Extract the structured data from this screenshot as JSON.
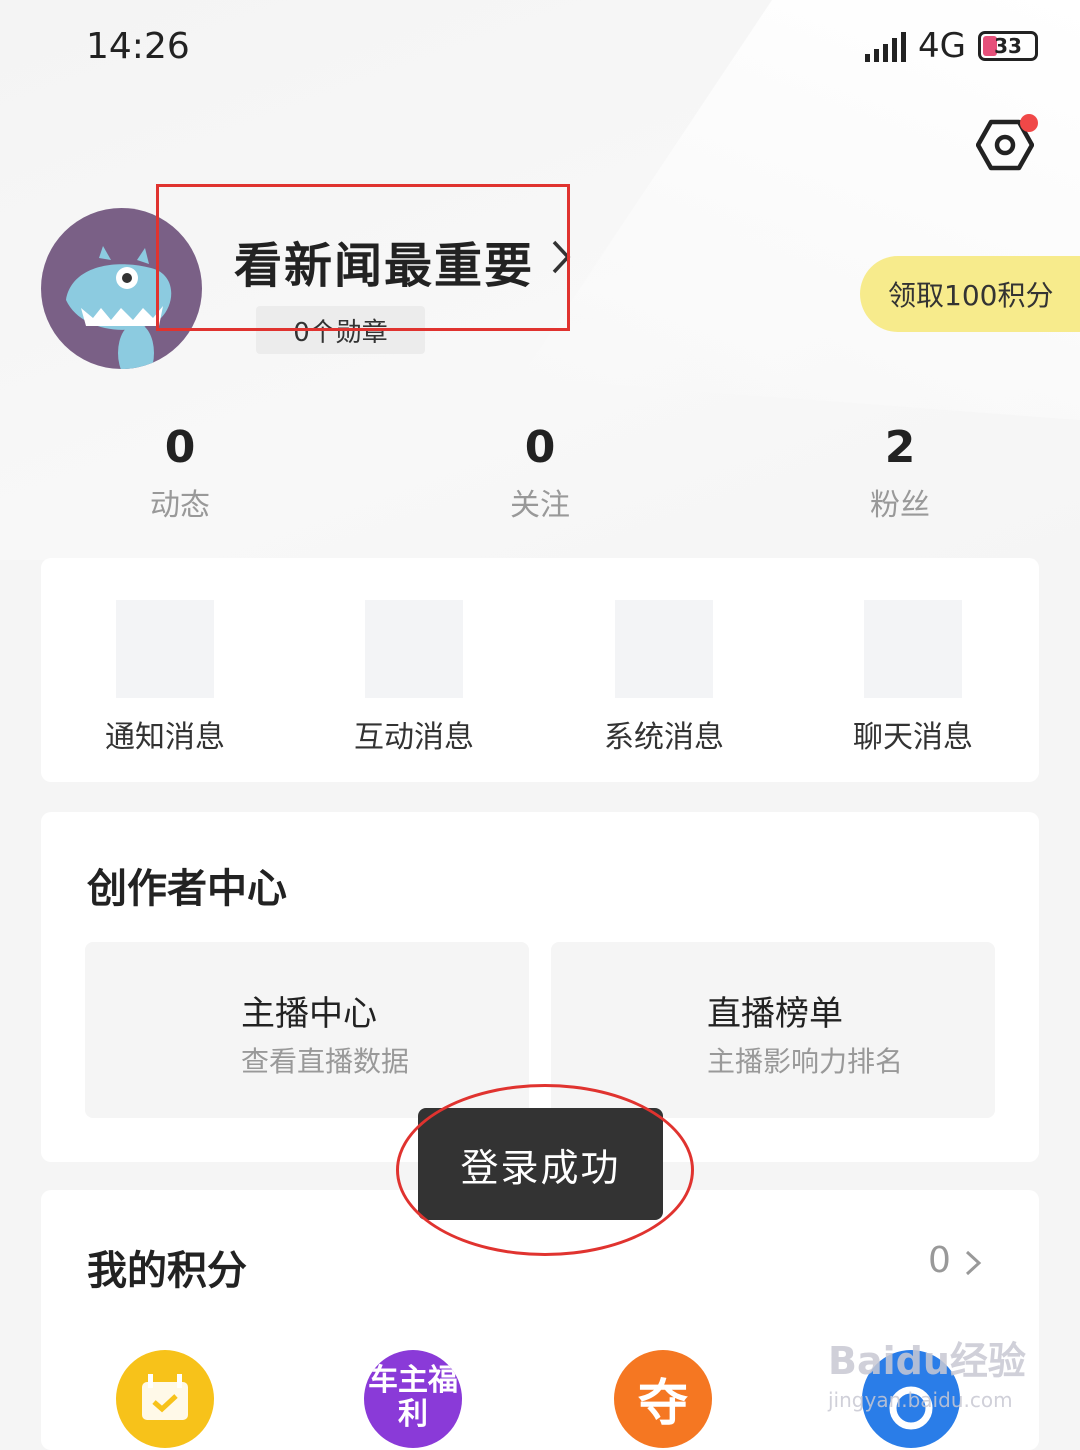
{
  "status_bar": {
    "time": "14:26",
    "network": "4G",
    "battery": "33"
  },
  "profile": {
    "username": "看新闻最重要",
    "badges": "0个勋章",
    "claim_points": "领取100积分"
  },
  "stats": [
    {
      "value": "0",
      "label": "动态"
    },
    {
      "value": "0",
      "label": "关注"
    },
    {
      "value": "2",
      "label": "粉丝"
    }
  ],
  "messages": [
    {
      "label": "通知消息"
    },
    {
      "label": "互动消息"
    },
    {
      "label": "系统消息"
    },
    {
      "label": "聊天消息"
    }
  ],
  "creator_center": {
    "title": "创作者中心",
    "items": [
      {
        "title": "主播中心",
        "desc": "查看直播数据"
      },
      {
        "title": "直播榜单",
        "desc": "主播影响力排名"
      }
    ]
  },
  "toast": {
    "text": "登录成功"
  },
  "my_points": {
    "title": "我的积分",
    "value": "0",
    "icons": [
      {
        "name": "calendar-checkin-icon",
        "color": "#f7c21a"
      },
      {
        "name": "car-owner-welfare-icon",
        "color": "#8a3ad8",
        "text": "车主福利"
      },
      {
        "name": "grab-icon",
        "color": "#f57722",
        "text": "夺"
      },
      {
        "name": "blue-reward-icon",
        "color": "#2a7de8"
      }
    ]
  },
  "watermark": {
    "text": "Baidu经验",
    "sub": "jingyan.baidu.com"
  },
  "colors": {
    "annotation_red": "#e0332f",
    "claim_yellow": "#f7eb8c",
    "notification_dot": "#f04848"
  }
}
